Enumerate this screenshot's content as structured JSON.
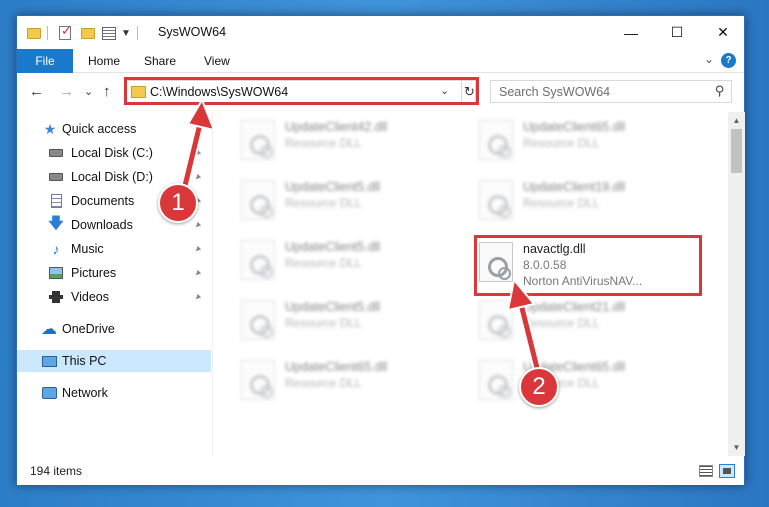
{
  "window": {
    "title": "SysWOW64",
    "controls": {
      "minimize": "—",
      "maximize": "☐",
      "close": "✕"
    }
  },
  "ribbon": {
    "file": "File",
    "tabs": [
      "Home",
      "Share",
      "View"
    ],
    "help": "?",
    "expand": "⌄"
  },
  "nav": {
    "back": "←",
    "forward": "→",
    "recent": "⌄",
    "up": "↑",
    "address": "C:\\Windows\\SysWOW64",
    "address_dropdown": "⌄",
    "refresh": "↻",
    "search_placeholder": "Search SysWOW64",
    "search_icon": "⚲"
  },
  "sidebar": {
    "items": [
      {
        "label": "Quick access",
        "icon": "star-icon"
      },
      {
        "label": "Local Disk (C:)",
        "icon": "drive-icon",
        "pinned": true
      },
      {
        "label": "Local Disk (D:)",
        "icon": "drive-icon",
        "pinned": true
      },
      {
        "label": "Documents",
        "icon": "document-icon",
        "pinned": true
      },
      {
        "label": "Downloads",
        "icon": "download-icon",
        "pinned": true
      },
      {
        "label": "Music",
        "icon": "music-icon",
        "pinned": true
      },
      {
        "label": "Pictures",
        "icon": "pictures-icon",
        "pinned": true
      },
      {
        "label": "Videos",
        "icon": "video-icon",
        "pinned": true
      },
      {
        "label": "OneDrive",
        "icon": "cloud-icon"
      },
      {
        "label": "This PC",
        "icon": "computer-icon",
        "selected": true
      },
      {
        "label": "Network",
        "icon": "network-icon"
      }
    ],
    "pin_glyph": "📌"
  },
  "files": [
    {
      "name": "UpdateClient42.dll",
      "type": "Resource DLL",
      "blurred": true
    },
    {
      "name": "UpdateClient65.dll",
      "type": "Resource DLL",
      "blurred": true
    },
    {
      "name": "UpdateClient5.dll",
      "type": "Resource DLL",
      "blurred": true
    },
    {
      "name": "UpdateClient19.dll",
      "type": "Resource DLL",
      "blurred": true
    },
    {
      "name": "UpdateClient5.dll",
      "type": "Resource DLL",
      "blurred": true
    },
    {
      "name": "navactlg.dll",
      "version": "8.0.0.58",
      "type": "Norton AntiVirusNAV...",
      "blurred": false,
      "highlighted": true
    },
    {
      "name": "UpdateClient5.dll",
      "type": "Resource DLL",
      "blurred": true
    },
    {
      "name": "UpdateClient21.dll",
      "type": "Resource DLL",
      "blurred": true
    },
    {
      "name": "UpdateClient65.dll",
      "type": "Resource DLL",
      "blurred": true
    },
    {
      "name": "UpdateClient65.dll",
      "type": "Resource DLL",
      "blurred": true
    }
  ],
  "status": {
    "count": "194 items"
  },
  "callouts": {
    "one": "1",
    "two": "2"
  },
  "colors": {
    "accent": "#1979ca",
    "highlight": "#d9373a",
    "desktop": "#2c7dc7",
    "selected": "#cce8ff"
  }
}
